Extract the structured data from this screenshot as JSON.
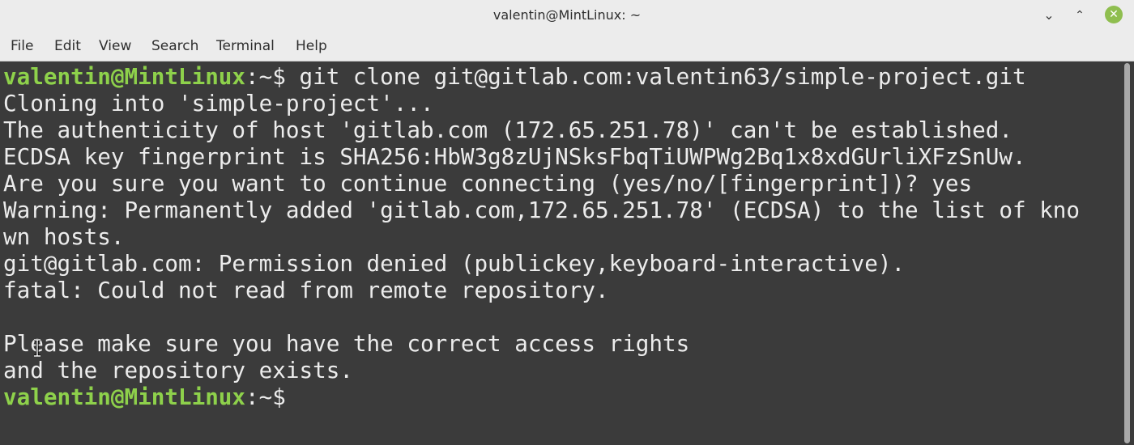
{
  "window": {
    "title": "valentin@MintLinux: ~",
    "minimize_glyph": "⌄",
    "maximize_glyph": "⌃",
    "close_glyph": "✕"
  },
  "menu": {
    "file": "File",
    "edit": "Edit",
    "view": "View",
    "search": "Search",
    "terminal": "Terminal",
    "help": "Help"
  },
  "terminal": {
    "prompt_user": "valentin@MintLinux",
    "prompt_path": ":~$ ",
    "command": "git clone git@gitlab.com:valentin63/simple-project.git",
    "output": [
      "Cloning into 'simple-project'...",
      "The authenticity of host 'gitlab.com (172.65.251.78)' can't be established.",
      "ECDSA key fingerprint is SHA256:HbW3g8zUjNSksFbqTiUWPWg2Bq1x8xdGUrliXFzSnUw.",
      "Are you sure you want to continue connecting (yes/no/[fingerprint])? yes",
      "Warning: Permanently added 'gitlab.com,172.65.251.78' (ECDSA) to the list of kno",
      "wn hosts.",
      "git@gitlab.com: Permission denied (publickey,keyboard-interactive).",
      "fatal: Could not read from remote repository.",
      "",
      "Please make sure you have the correct access rights",
      "and the repository exists."
    ],
    "final_prompt_path": ":~$"
  },
  "colors": {
    "prompt_green": "#8ed14b",
    "terminal_bg": "#3b3b3b",
    "terminal_fg": "#ececec",
    "close_button": "#8fbe4f"
  },
  "icons": {
    "minimize": "minimize-icon",
    "maximize": "maximize-icon",
    "close": "close-icon",
    "mouse_cursor": "text-cursor-icon"
  }
}
